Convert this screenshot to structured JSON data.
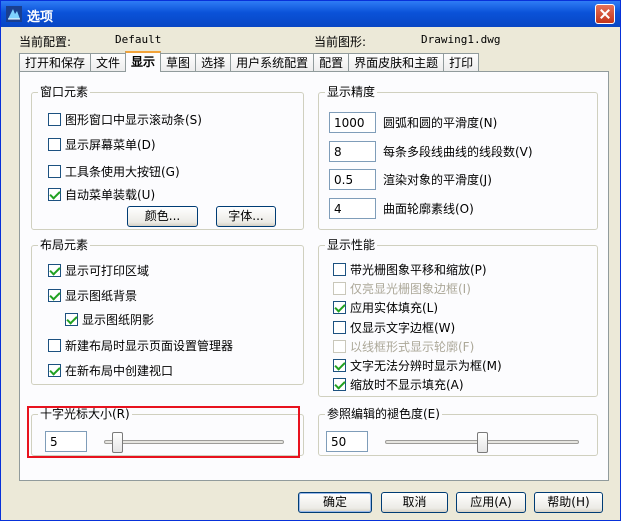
{
  "window": {
    "title": "选项"
  },
  "info": {
    "profile_label": "当前配置:",
    "profile_value": "Default",
    "drawing_label": "当前图形:",
    "drawing_value": "Drawing1.dwg"
  },
  "tabs": [
    {
      "label": "打开和保存"
    },
    {
      "label": "文件"
    },
    {
      "label": "显示",
      "active": true
    },
    {
      "label": "草图"
    },
    {
      "label": "选择"
    },
    {
      "label": "用户系统配置"
    },
    {
      "label": "配置"
    },
    {
      "label": "界面皮肤和主题"
    },
    {
      "label": "打印"
    }
  ],
  "window_elements": {
    "title": "窗口元素",
    "items": [
      {
        "label": "图形窗口中显示滚动条(S)",
        "checked": false
      },
      {
        "label": "显示屏幕菜单(D)",
        "checked": false
      },
      {
        "label": "工具条使用大按钮(G)",
        "checked": false
      },
      {
        "label": "自动菜单装载(U)",
        "checked": true
      }
    ],
    "colors_button": "颜色...",
    "fonts_button": "字体..."
  },
  "display_precision": {
    "title": "显示精度",
    "items": [
      {
        "value": "1000",
        "label": "圆弧和圆的平滑度(N)"
      },
      {
        "value": "8",
        "label": "每条多段线曲线的线段数(V)"
      },
      {
        "value": "0.5",
        "label": "渲染对象的平滑度(J)"
      },
      {
        "value": "4",
        "label": "曲面轮廓素线(O)"
      }
    ]
  },
  "layout_elements": {
    "title": "布局元素",
    "items": [
      {
        "label": "显示可打印区域",
        "checked": true
      },
      {
        "label": "显示图纸背景",
        "checked": true
      },
      {
        "label": "显示图纸阴影",
        "checked": true
      },
      {
        "label": "新建布局时显示页面设置管理器",
        "checked": false
      },
      {
        "label": "在新布局中创建视口",
        "checked": true
      }
    ]
  },
  "display_performance": {
    "title": "显示性能",
    "items": [
      {
        "label": "带光栅图象平移和缩放(P)",
        "checked": false,
        "disabled": false
      },
      {
        "label": "仅亮显光栅图象边框(I)",
        "checked": false,
        "disabled": true
      },
      {
        "label": "应用实体填充(L)",
        "checked": true,
        "disabled": false
      },
      {
        "label": "仅显示文字边框(W)",
        "checked": false,
        "disabled": false
      },
      {
        "label": "以线框形式显示轮廓(F)",
        "checked": false,
        "disabled": true
      },
      {
        "label": "文字无法分辨时显示为框(M)",
        "checked": true,
        "disabled": false
      },
      {
        "label": "缩放时不显示填充(A)",
        "checked": true,
        "disabled": false
      }
    ]
  },
  "crosshair": {
    "title": "十字光标大小(R)",
    "value": "5",
    "slider_level_percent": 5
  },
  "xref_fading": {
    "title": "参照编辑的褪色度(E)",
    "value": "50",
    "slider_level_percent": 50
  },
  "footer": {
    "ok": "确定",
    "cancel": "取消",
    "apply": "应用(A)",
    "help": "帮助(H)"
  },
  "colors": {
    "highlight": "#e8121e",
    "titlebar": "#0a52d8",
    "active_tab_accent": "#f2a33a"
  }
}
